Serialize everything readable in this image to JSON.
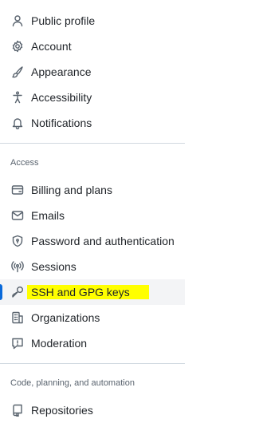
{
  "top_items": [
    {
      "label": "Public profile",
      "icon": "person-icon"
    },
    {
      "label": "Account",
      "icon": "gear-icon"
    },
    {
      "label": "Appearance",
      "icon": "paintbrush-icon"
    },
    {
      "label": "Accessibility",
      "icon": "accessibility-icon"
    },
    {
      "label": "Notifications",
      "icon": "bell-icon"
    }
  ],
  "access": {
    "heading": "Access",
    "items": [
      {
        "label": "Billing and plans",
        "icon": "credit-card-icon"
      },
      {
        "label": "Emails",
        "icon": "mail-icon"
      },
      {
        "label": "Password and authentication",
        "icon": "shield-lock-icon"
      },
      {
        "label": "Sessions",
        "icon": "broadcast-icon"
      },
      {
        "label": "SSH and GPG keys",
        "icon": "key-icon",
        "selected": true,
        "highlight_color": "#ffff00"
      },
      {
        "label": "Organizations",
        "icon": "organization-icon"
      },
      {
        "label": "Moderation",
        "icon": "report-icon"
      }
    ]
  },
  "code": {
    "heading": "Code, planning, and automation",
    "items": [
      {
        "label": "Repositories",
        "icon": "repo-icon"
      }
    ]
  },
  "accent_color": "#0969da"
}
